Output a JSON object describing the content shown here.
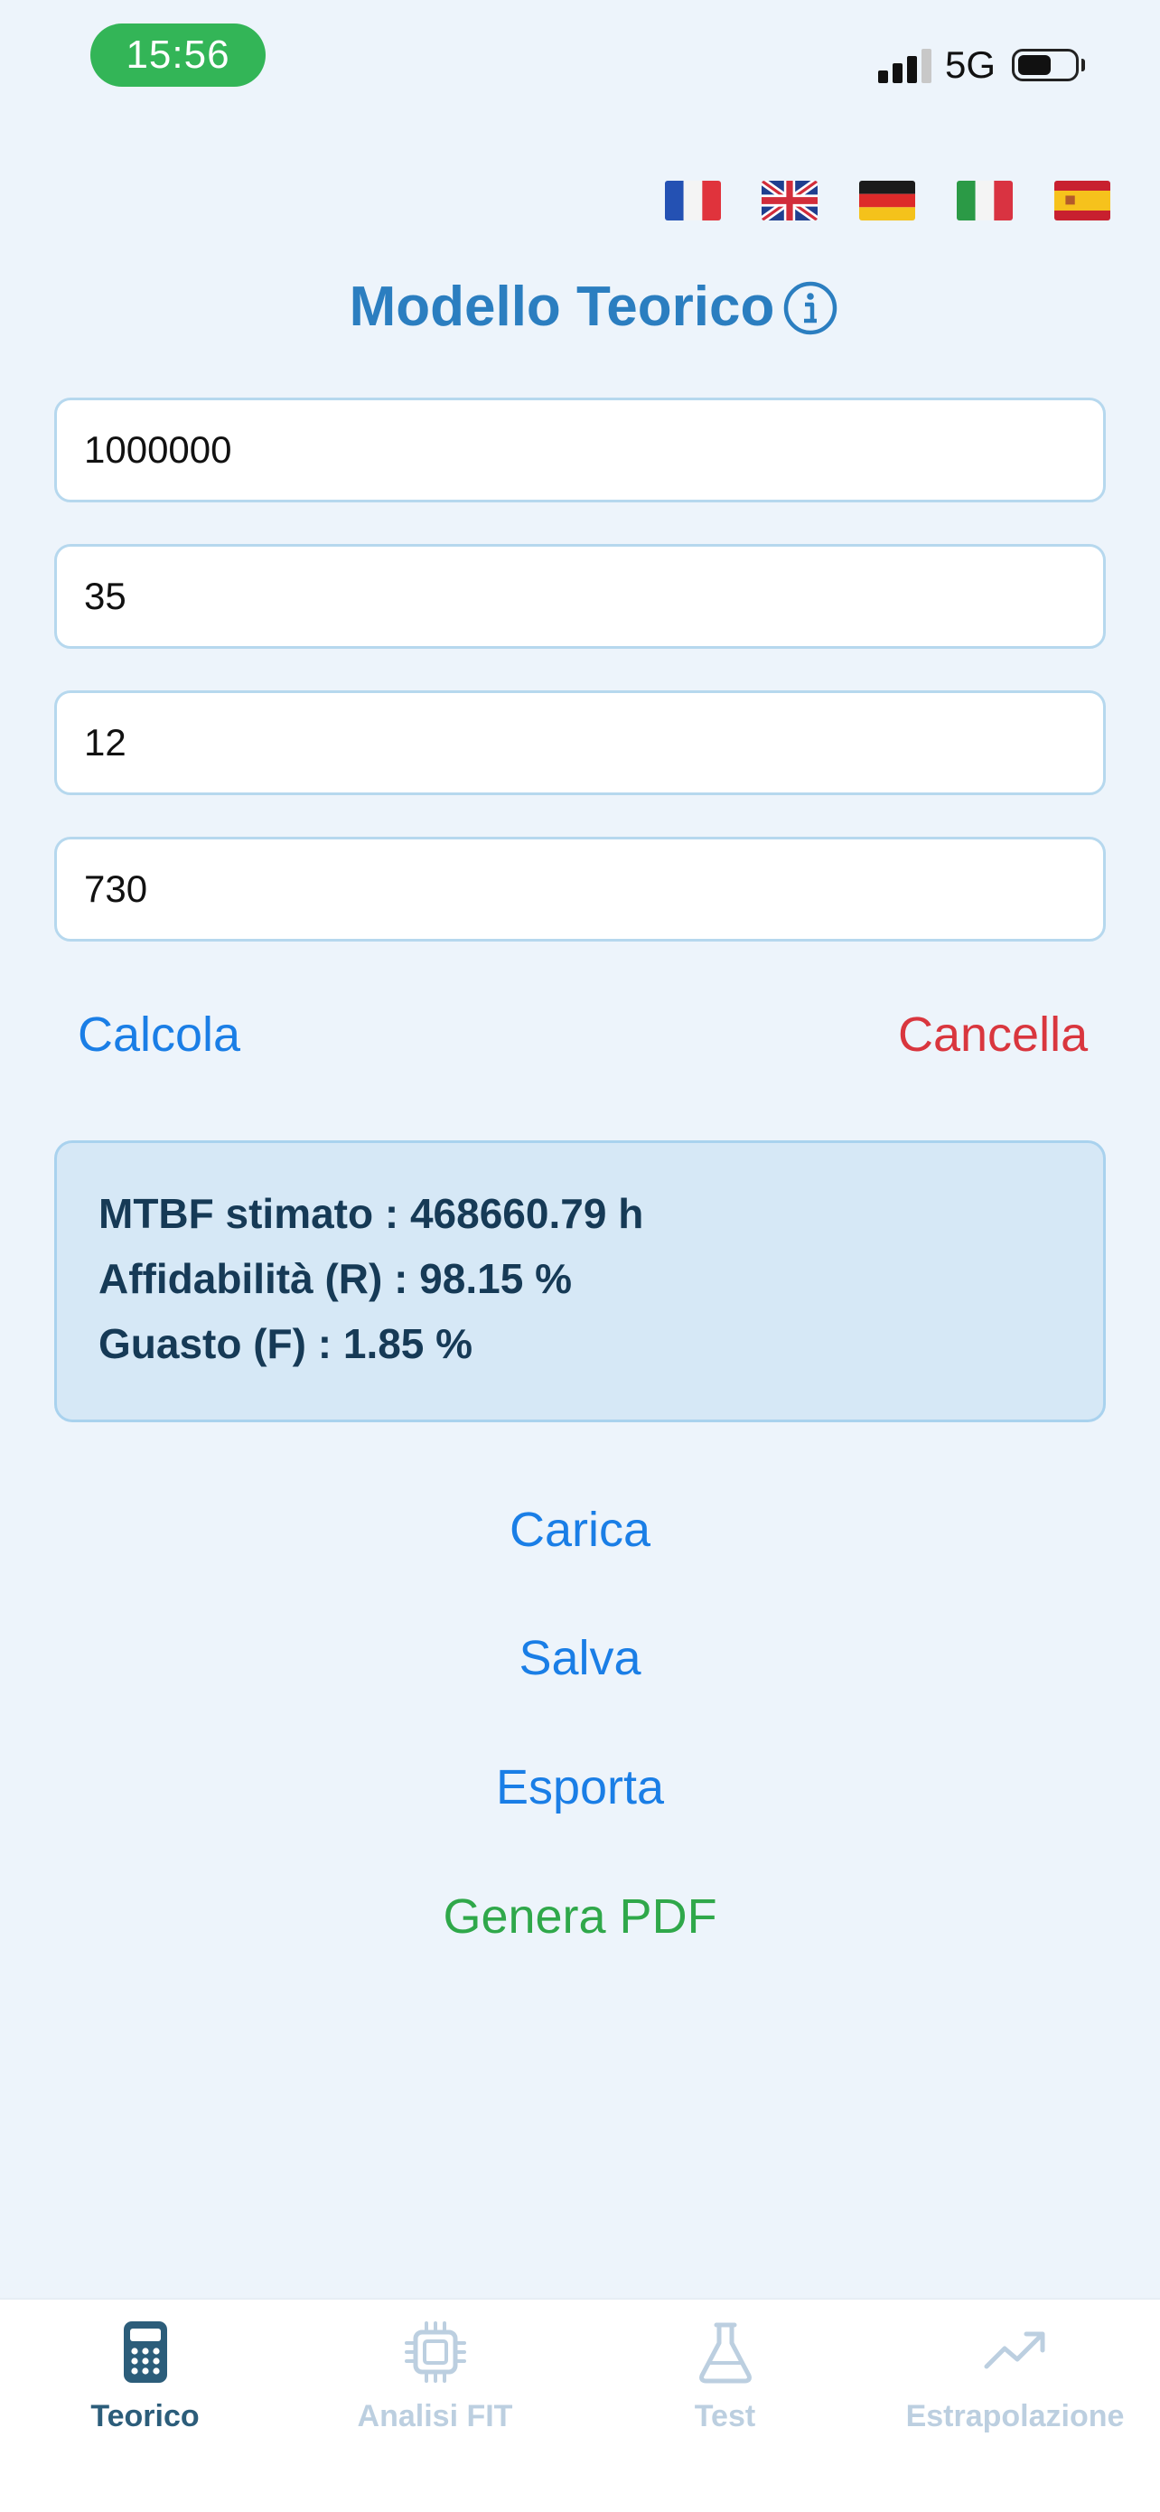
{
  "status_bar": {
    "time": "15:56",
    "network": "5G",
    "signal_bars_active": 3,
    "battery_level": 0.5
  },
  "flags": [
    {
      "icon": "flag-france-icon"
    },
    {
      "icon": "flag-uk-icon"
    },
    {
      "icon": "flag-germany-icon"
    },
    {
      "icon": "flag-italy-icon"
    },
    {
      "icon": "flag-spain-icon"
    }
  ],
  "header": {
    "title": "Modello Teorico",
    "info_icon": "info-circle-icon"
  },
  "inputs": [
    {
      "value": "1000000"
    },
    {
      "value": "35"
    },
    {
      "value": "12"
    },
    {
      "value": "730"
    }
  ],
  "actions": {
    "calculate": "Calcola",
    "clear": "Cancella"
  },
  "results": {
    "mtbf": "MTBF stimato : 468660.79 h",
    "reliability": "Affidabilità (R) : 98.15 %",
    "failure": "Guasto (F) : 1.85 %"
  },
  "file_actions": {
    "load": "Carica",
    "save": "Salva",
    "export": "Esporta",
    "pdf": "Genera PDF"
  },
  "tabs": [
    {
      "label": "Teorico",
      "icon": "calculator-icon",
      "active": true
    },
    {
      "label": "Analisi FIT",
      "icon": "chip-icon",
      "active": false
    },
    {
      "label": "Test",
      "icon": "flask-icon",
      "active": false
    },
    {
      "label": "Estrapolazione",
      "icon": "trend-up-icon",
      "active": false
    }
  ],
  "colors": {
    "background": "#edf4fb",
    "title": "#2b7ec0",
    "link_blue": "#1a7ee6",
    "link_red": "#d9363e",
    "link_green": "#2fa84a",
    "tab_active": "#2c5d7a",
    "tab_inactive": "#bccfe0"
  }
}
